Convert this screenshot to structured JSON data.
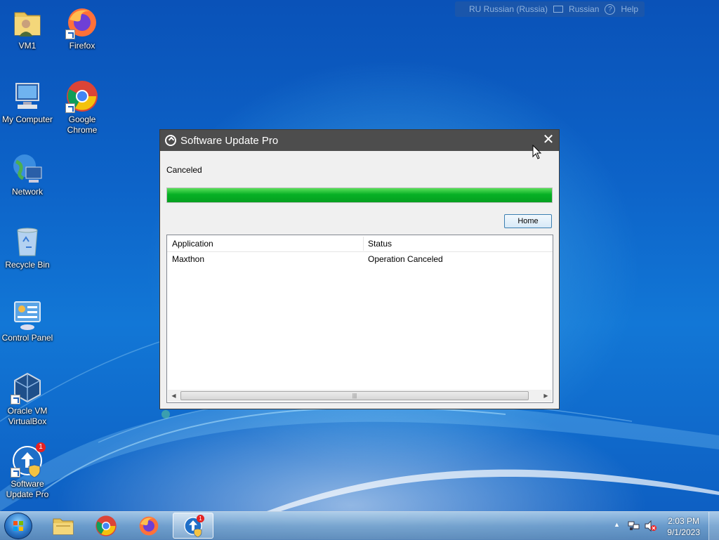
{
  "langbar": {
    "language": "RU Russian (Russia)",
    "keyboard": "Russian",
    "help": "Help"
  },
  "desktop": {
    "icons": [
      {
        "label": "VM1",
        "icon": "user-folder-icon"
      },
      {
        "label": "Firefox",
        "icon": "firefox-icon"
      },
      {
        "label": "My Computer",
        "icon": "computer-icon"
      },
      {
        "label": "Google Chrome",
        "icon": "chrome-icon"
      },
      {
        "label": "Network",
        "icon": "network-icon"
      },
      {
        "label": "Recycle Bin",
        "icon": "recycle-bin-icon"
      },
      {
        "label": "Control Panel",
        "icon": "control-panel-icon"
      },
      {
        "label": "Oracle VM VirtualBox",
        "icon": "virtualbox-icon"
      },
      {
        "label": "Software Update Pro",
        "icon": "software-update-icon",
        "badge": "1"
      }
    ]
  },
  "dialog": {
    "title": "Software Update Pro",
    "close": "✕",
    "status": "Canceled",
    "progress": 1.0,
    "home_button": "Home",
    "list": {
      "columns": [
        "Application",
        "Status"
      ],
      "rows": [
        {
          "application": "Maxthon",
          "status": "Operation Canceled"
        }
      ]
    },
    "scroll_left": "◀",
    "scroll_right": "▶",
    "scroll_grip": "|||"
  },
  "taskbar": {
    "pinned": [
      "explorer-icon",
      "chrome-icon",
      "firefox-icon",
      "software-update-icon"
    ],
    "active_badge": "1",
    "tray_expand": "▲",
    "clock": {
      "time": "2:03 PM",
      "date": "9/1/2023"
    }
  },
  "colors": {
    "progress_fill": "#06b025",
    "titlebar": "#4d4d4d"
  }
}
